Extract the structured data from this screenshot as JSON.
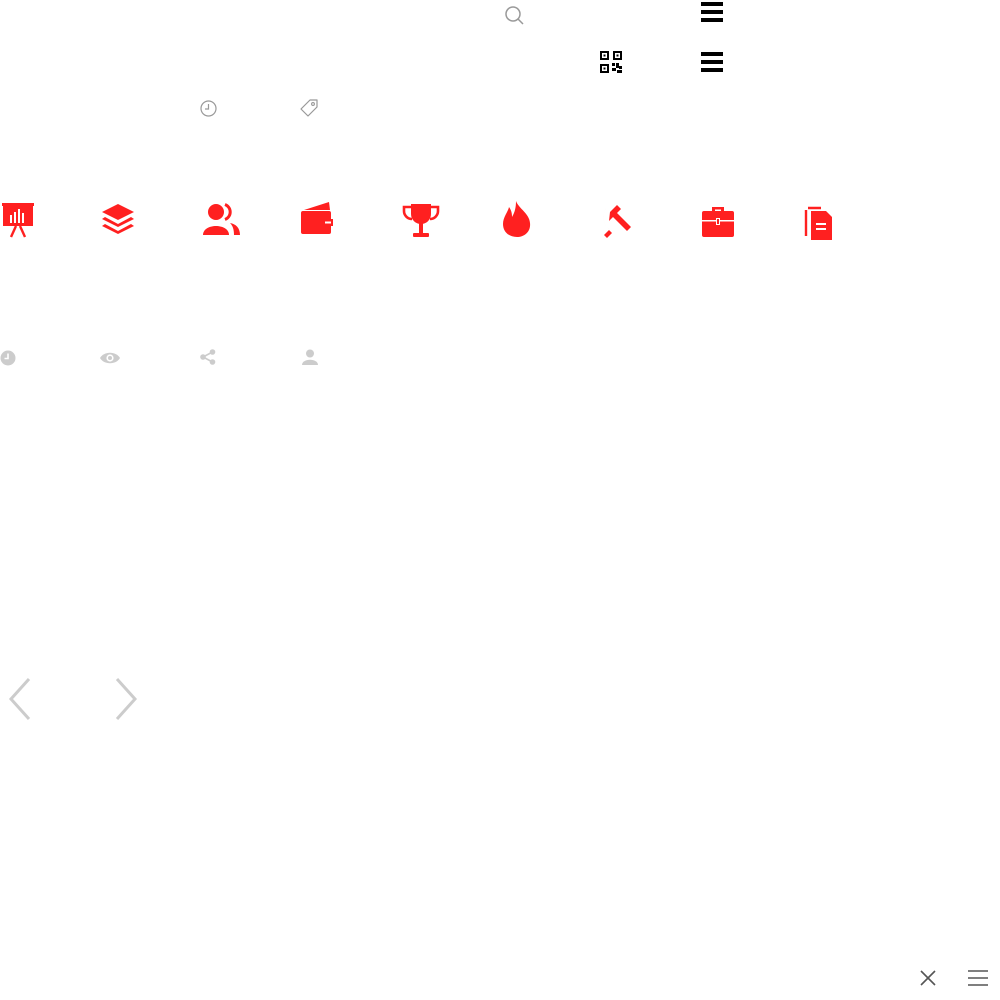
{
  "colors": {
    "accent_red": "#ff2020",
    "icon_gray": "#cccccc",
    "icon_black": "#000000",
    "outline_gray": "#999999"
  },
  "header_icons": [
    "search-icon",
    "menu-icon",
    "qr-code-icon",
    "menu-icon",
    "clock-outline-icon",
    "tag-outline-icon"
  ],
  "category_icons": [
    "presentation-chart-icon",
    "layers-icon",
    "users-icon",
    "wallet-icon",
    "trophy-icon",
    "fire-icon",
    "hammer-sickle-icon",
    "briefcase-icon",
    "documents-icon"
  ],
  "meta_icons": [
    "clock-icon",
    "eye-icon",
    "share-icon",
    "user-icon"
  ],
  "carousel_icons": [
    "chevron-left-icon",
    "chevron-right-icon"
  ],
  "corner_icons": [
    "close-icon",
    "hamburger-icon"
  ]
}
